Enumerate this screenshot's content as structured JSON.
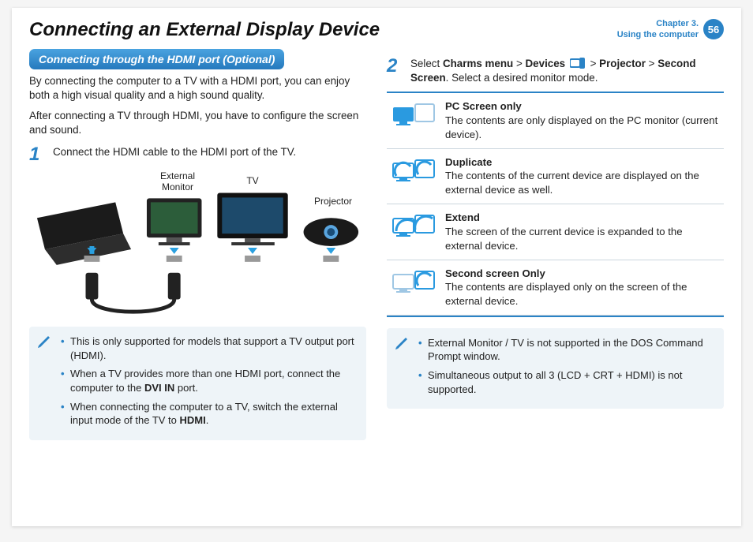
{
  "header": {
    "title": "Connecting an External Display Device",
    "chapter_line1": "Chapter 3.",
    "chapter_line2": "Using the computer",
    "page_number": "56"
  },
  "left": {
    "section_bar": "Connecting through the HDMI port (Optional)",
    "intro_p1": "By connecting the computer to a TV with a HDMI port, you can enjoy both a high visual quality and a high sound quality.",
    "intro_p2": "After connecting a TV through HDMI, you have to configure the screen and sound.",
    "step1_num": "1",
    "step1_text": "Connect the HDMI cable to the HDMI port of the TV.",
    "diagram_labels": {
      "external_monitor": "External\nMonitor",
      "tv": "TV",
      "projector": "Projector"
    },
    "note_items": [
      "This is only supported for models that support a TV output port (HDMI).",
      "When a TV provides more than one HDMI port, connect the computer to the ",
      "When connecting the computer to a TV, switch the external input mode of the TV to "
    ],
    "note_bold2": "DVI IN",
    "note_tail2": " port.",
    "note_bold3": "HDMI",
    "note_tail3": "."
  },
  "right": {
    "step2_num": "2",
    "step2_pre": "Select ",
    "step2_b1": "Charms menu",
    "step2_gt": " > ",
    "step2_b2": "Devices",
    "step2_b3": "Projector",
    "step2_b4": "Second Screen",
    "step2_tail": ". Select a desired monitor mode.",
    "modes": [
      {
        "title": "PC Screen only",
        "desc": "The contents are only displayed on the PC monitor (current device)."
      },
      {
        "title": "Duplicate",
        "desc": "The contents of the current device are displayed on the external device as well."
      },
      {
        "title": "Extend",
        "desc": "The screen of the current device is expanded to the external device."
      },
      {
        "title": "Second screen Only",
        "desc": "The contents are displayed only on the screen of the external device."
      }
    ],
    "note_items": [
      "External Monitor / TV is not supported in the DOS Command Prompt window.",
      "Simultaneous output to all 3 (LCD + CRT + HDMI) is not supported."
    ]
  }
}
